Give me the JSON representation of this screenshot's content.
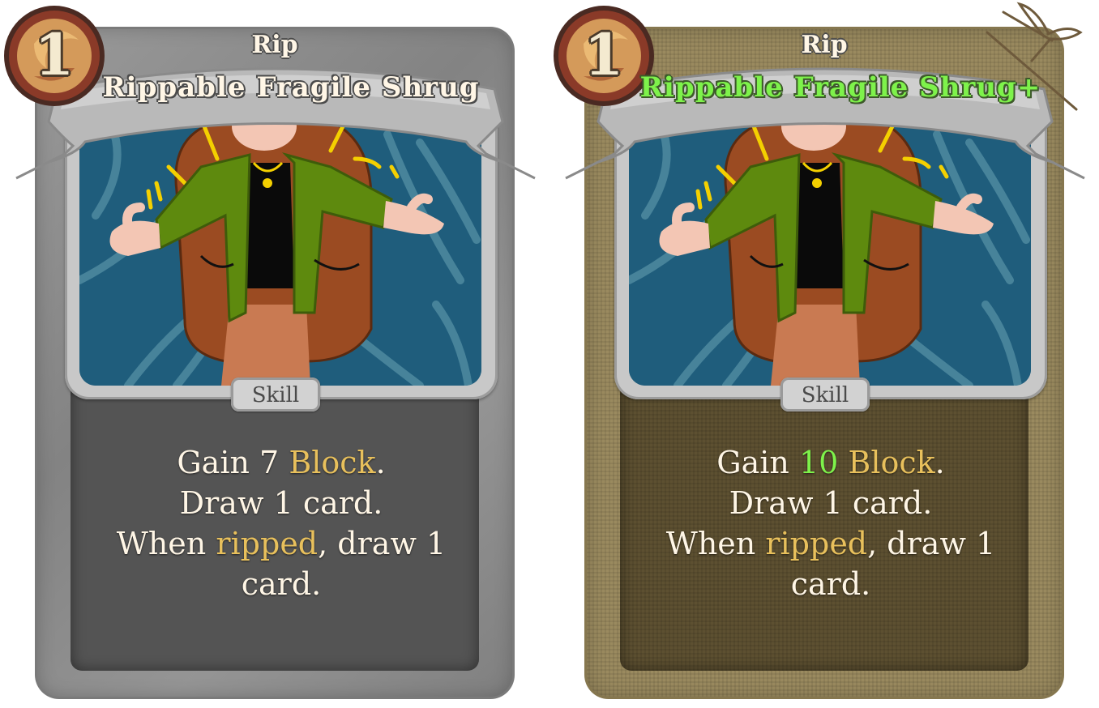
{
  "cards": [
    {
      "cost": "1",
      "subtitle": "Rip",
      "title": "Rippable Fragile Shrug",
      "type": "Skill",
      "desc": {
        "line1_pre": "Gain ",
        "line1_amount": "7",
        "line1_kw": "Block",
        "line1_post": ".",
        "line2": "Draw 1 card.",
        "line3_pre": "When ",
        "line3_kw": "ripped",
        "line3_post": ", draw 1",
        "line4": "card."
      }
    },
    {
      "cost": "1",
      "subtitle": "Rip",
      "title": "Rippable Fragile Shrug+",
      "type": "Skill",
      "desc": {
        "line1_pre": "Gain ",
        "line1_amount": "10",
        "line1_kw": "Block",
        "line1_post": ".",
        "line2": "Draw 1 card.",
        "line3_pre": "When ",
        "line3_kw": "ripped",
        "line3_post": ", draw 1",
        "line4": "card."
      }
    }
  ],
  "colors": {
    "keyword": "#e8c05c",
    "upgraded": "#7ef24b",
    "base_card": "#8e8e8e",
    "upgraded_card": "#9a8a5f"
  }
}
